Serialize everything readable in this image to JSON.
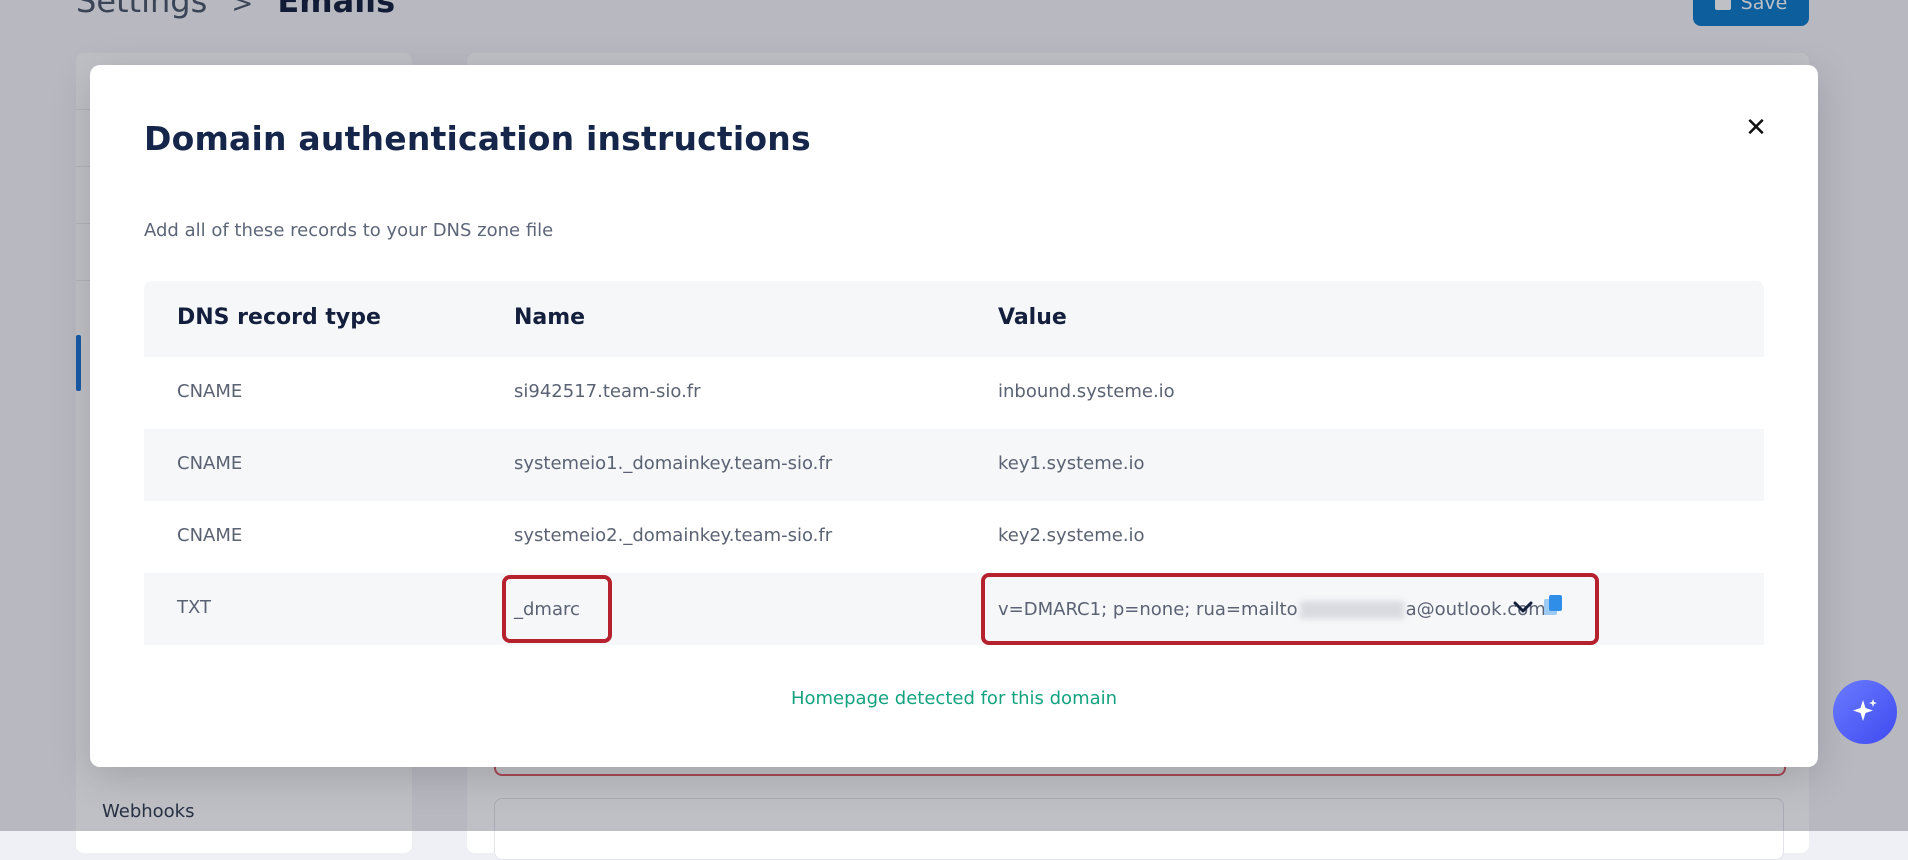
{
  "header": {
    "breadcrumb_parent": "Settings",
    "breadcrumb_current": "Emails",
    "save_label": "Save"
  },
  "sidebar": {
    "visible_items": [
      "Webhooks"
    ]
  },
  "modal": {
    "title": "Domain authentication instructions",
    "subtitle": "Add all of these records to your DNS zone file",
    "columns": [
      "DNS record type",
      "Name",
      "Value"
    ],
    "records": [
      {
        "type": "CNAME",
        "name": "si942517.team-sio.fr",
        "value": "inbound.systeme.io"
      },
      {
        "type": "CNAME",
        "name": "systemeio1._domainkey.team-sio.fr",
        "value": "key1.systeme.io"
      },
      {
        "type": "CNAME",
        "name": "systemeio2._domainkey.team-sio.fr",
        "value": "key2.systeme.io"
      },
      {
        "type": "TXT",
        "name": "_dmarc",
        "value_prefix": "v=DMARC1; p=none; rua=mailto",
        "value_suffix": "a@outlook.com"
      }
    ],
    "status_message": "Homepage detected for this domain"
  },
  "colors": {
    "accent": "#0b79c8",
    "highlight": "#b5222e",
    "success": "#14a37f",
    "title": "#15264a"
  }
}
